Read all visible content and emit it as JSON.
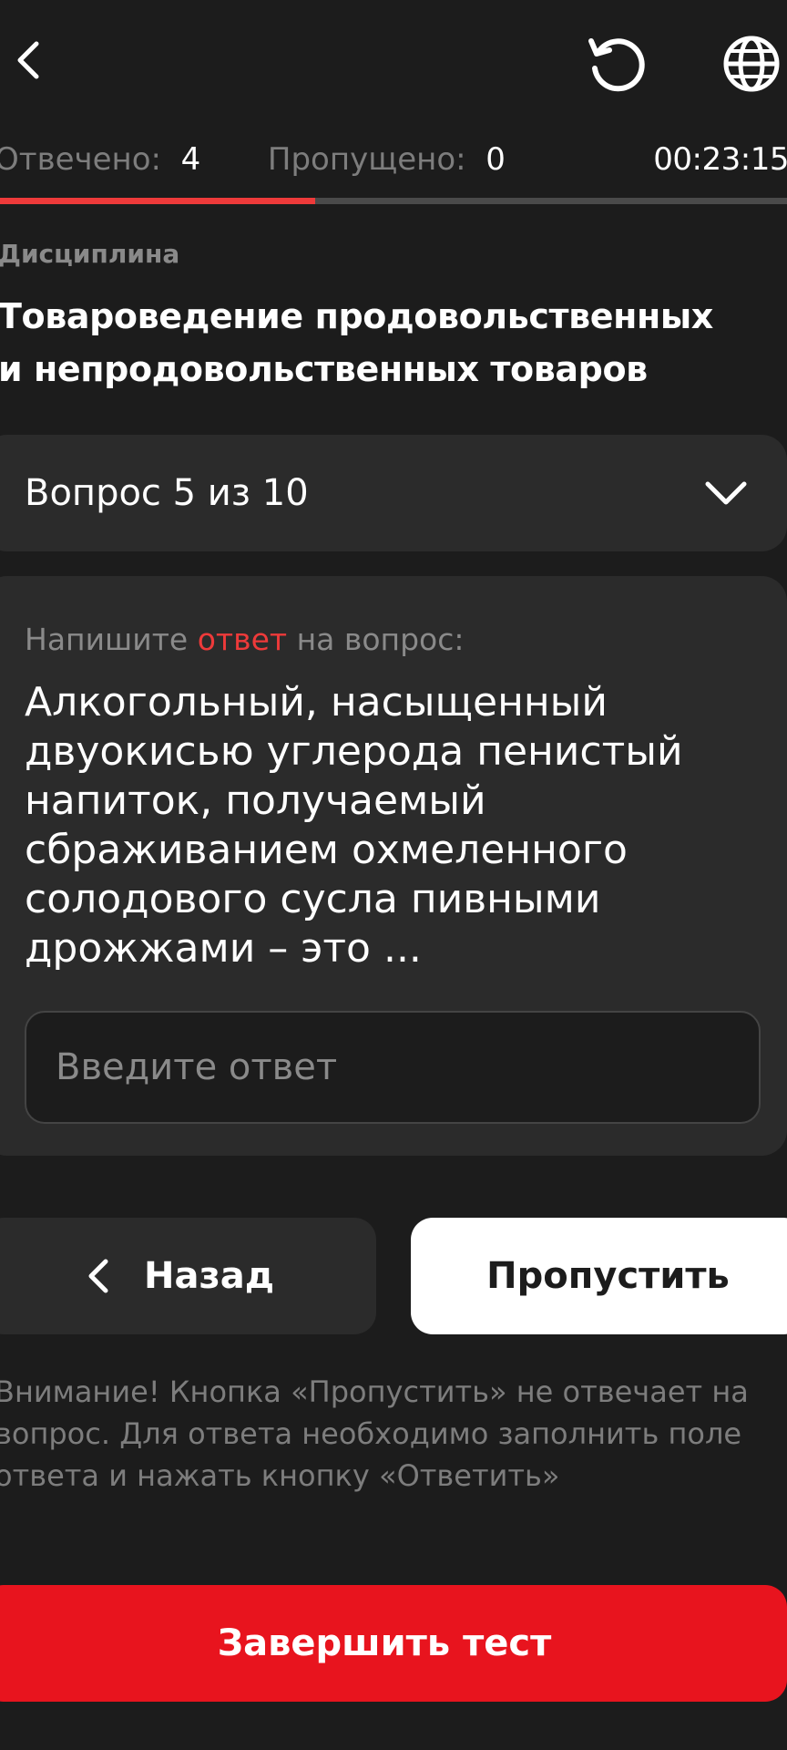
{
  "header": {
    "back_icon": "chevron-left-icon",
    "reset_icon": "refresh-icon",
    "language_icon": "globe-icon"
  },
  "stats": {
    "answered_label": "Отвечено:",
    "answered_value": "4",
    "skipped_label": "Пропущено:",
    "skipped_value": "0",
    "timer": "00:23:15"
  },
  "progress": {
    "fraction": 0.4,
    "fill_color": "#ee3a3a",
    "track_color": "#4a4a4a"
  },
  "discipline": {
    "label": "Дисциплина",
    "title": "Товароведение продовольственных и непродовольственных товаров"
  },
  "question_selector": {
    "label": "Вопрос 5 из 10",
    "icon": "chevron-down-icon"
  },
  "question": {
    "instruction_before": "Напишите ",
    "instruction_accent": "ответ",
    "instruction_after": " на вопрос:",
    "text": "Алкогольный, насыщенный двуокисью углерода пенистый напиток, получаемый сбраживанием охмеленного солодового сусла пивными дрожжами – это ...",
    "answer_placeholder": "Введите ответ",
    "answer_value": ""
  },
  "buttons": {
    "back_label": "Назад",
    "skip_label": "Пропустить",
    "finish_label": "Завершить тест"
  },
  "warning": "Внимание! Кнопка «Пропустить» не отвечает на вопрос. Для ответа необходимо заполнить поле ответа и нажать кнопку «Ответить»",
  "colors": {
    "background": "#1c1c1c",
    "card": "#2b2b2b",
    "accent": "#ee3a3a",
    "finish_button": "#e8141e"
  }
}
